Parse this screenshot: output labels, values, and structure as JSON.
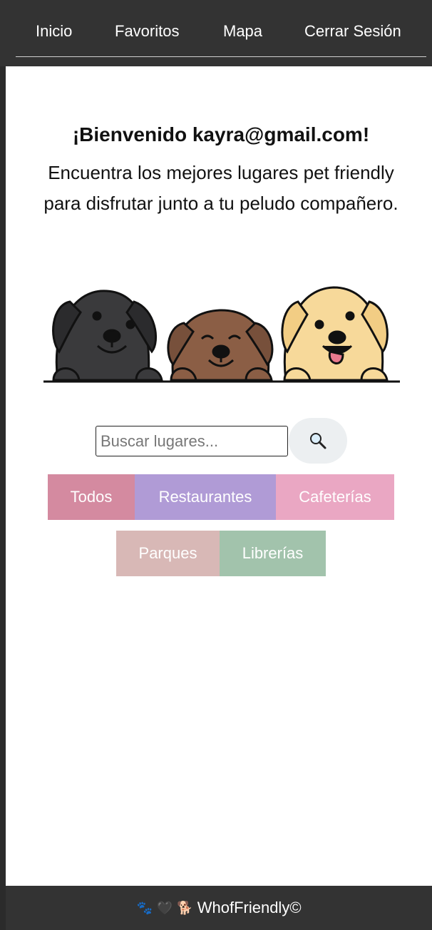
{
  "nav": {
    "items": [
      {
        "label": "Inicio"
      },
      {
        "label": "Favoritos"
      },
      {
        "label": "Mapa"
      },
      {
        "label": "Cerrar Sesión"
      }
    ]
  },
  "main": {
    "welcome": "¡Bienvenido kayra@gmail.com!",
    "subtitle": "Encuentra los mejores lugares pet friendly para disfrutar junto a tu peludo compañero."
  },
  "search": {
    "placeholder": "Buscar lugares...",
    "button_icon": "magnifier-icon"
  },
  "categories": [
    {
      "label": "Todos",
      "color": "#d48aa0"
    },
    {
      "label": "Restaurantes",
      "color": "#b09bd6"
    },
    {
      "label": "Cafeterías",
      "color": "#eaa7c3"
    },
    {
      "label": "Parques",
      "color": "#d8b8b6"
    },
    {
      "label": "Librerías",
      "color": "#a2c3ac"
    }
  ],
  "footer": {
    "icons": [
      "paw-icon",
      "black-heart-icon",
      "dog-icon"
    ],
    "brand": "WhofFriendly©"
  },
  "colors": {
    "header": "#333333",
    "dog_black": "#3a3a3c",
    "dog_brown": "#8b5e45",
    "dog_golden": "#f7d99a"
  }
}
